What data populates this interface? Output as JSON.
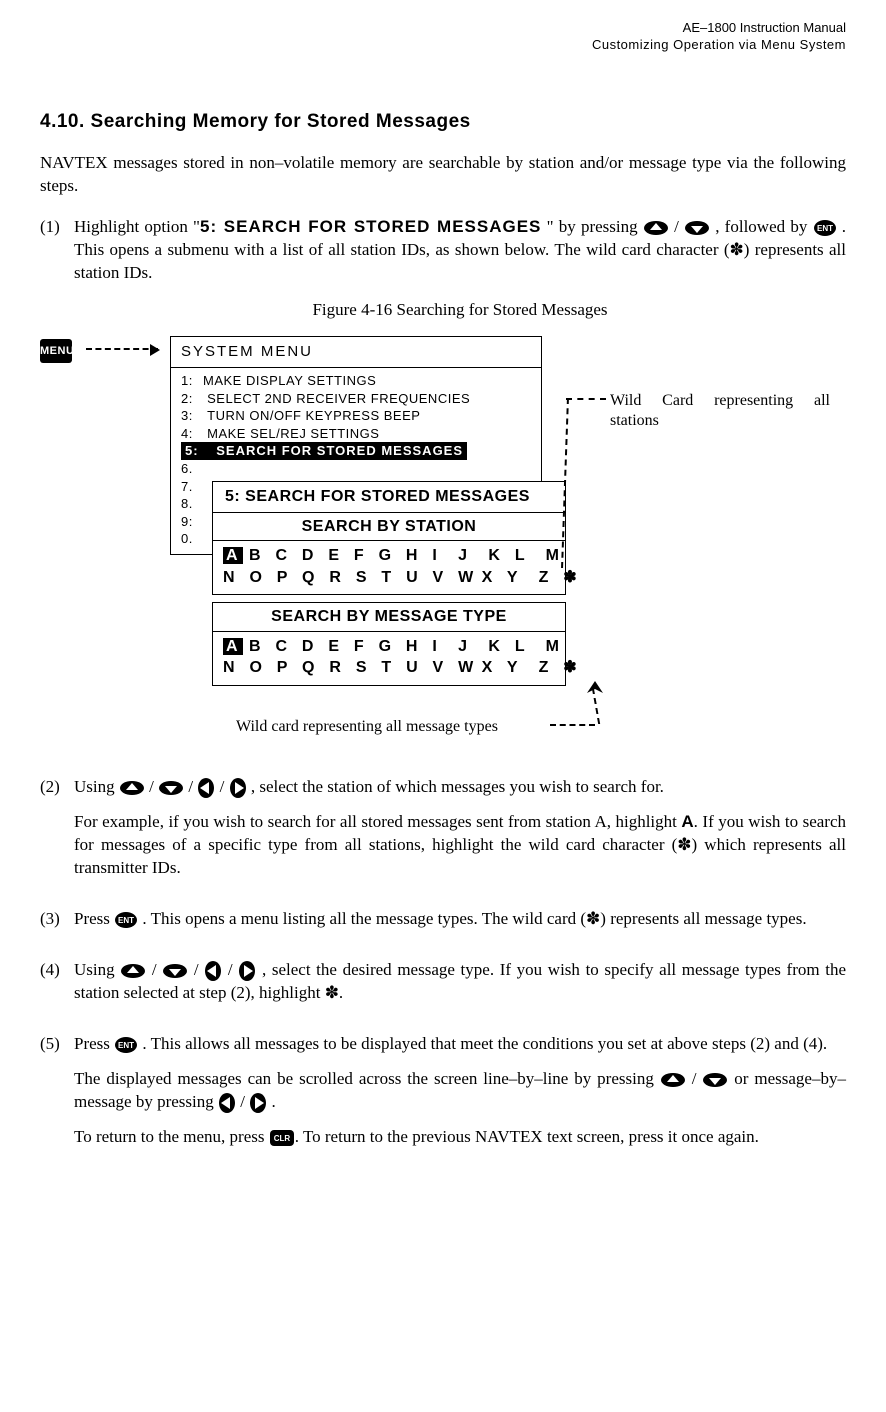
{
  "header": {
    "line1": "AE–1800 Instruction Manual",
    "line2": "Customizing Operation via Menu System"
  },
  "section": {
    "title": "4.10. Searching Memory for Stored Messages",
    "intro": "NAVTEX messages stored in non–volatile memory are searchable by station and/or message type via the following steps."
  },
  "figcap": "Figure 4-16   Searching for Stored Messages",
  "menuBtn": "MENU",
  "sysmenu": {
    "title": "SYSTEM MENU",
    "rows": [
      {
        "num": "1:",
        "text": "MAKE DISPLAY SETTINGS"
      },
      {
        "num": "2:",
        "text": "SELECT 2ND RECEIVER FREQUENCIES"
      },
      {
        "num": "3:",
        "text": "TURN ON/OFF KEYPRESS BEEP"
      },
      {
        "num": "4:",
        "text": "MAKE SEL/REJ SETTINGS"
      }
    ],
    "selnum": "5:",
    "seltext": "SEARCH FOR STORED MESSAGES",
    "rest": [
      "6.",
      "7.",
      "8.",
      "9:",
      "0."
    ]
  },
  "sub1": {
    "title": "5: SEARCH FOR STORED MESSAGES",
    "head": "SEARCH BY STATION",
    "sel": "A",
    "line1_rest": " B  C  D  E  F  G  H  I   J   K  L   M",
    "line2": "N  O  P  Q  R  S  T  U  V  W X  Y   Z  ✽"
  },
  "sub2": {
    "head": "SEARCH BY MESSAGE TYPE",
    "sel": "A",
    "line1_rest": " B  C  D  E  F  G  H  I   J   K  L   M",
    "line2": "N  O  P  Q  R  S  T  U  V  W X  Y   Z  ✽"
  },
  "ann1": "Wild Card representing all stations",
  "ann2": "Wild card representing all message types",
  "steps": {
    "s1": {
      "num": "(1)",
      "p1a": "Highlight option \"",
      "opt": "5: SEARCH FOR STORED MESSAGES",
      "p1b": " \" by pressing ",
      "p1c": " , followed by ",
      "p1d": " . This opens a submenu with a list of all station IDs, as shown below. The wild card character (✽) represents all station IDs."
    },
    "s2": {
      "num": "(2)",
      "p1a": "Using ",
      "p1b": ", select the station of which messages you wish to search for.",
      "p2a": "For example, if you wish to search for all stored messages sent from station A, highlight ",
      "lblA": "A",
      "p2b": ". If you wish to search for messages of a specific type from all stations, highlight the wild card character (✽) which represents all transmitter IDs."
    },
    "s3": {
      "num": "(3)",
      "p1a": "Press ",
      "p1b": " . This opens a menu listing all the message types. The wild card (✽) represents all message types."
    },
    "s4": {
      "num": "(4)",
      "p1a": "Using ",
      "p1b": ", select the desired message type. If you wish to specify all message types from the station selected at step (2), highlight  ✽."
    },
    "s5": {
      "num": "(5)",
      "p1a": "Press ",
      "p1b": " . This allows all messages to be displayed that meet the conditions you set at above steps (2) and (4).",
      "p2a": "The displayed messages can be scrolled across the screen line–by–line by pressing ",
      "p2b": "  or message–by–message by pressing ",
      "p2c": " .",
      "p3a": "To return to the menu, press ",
      "p3b": ". To return to the previous NAVTEX text screen, press it once again."
    }
  }
}
